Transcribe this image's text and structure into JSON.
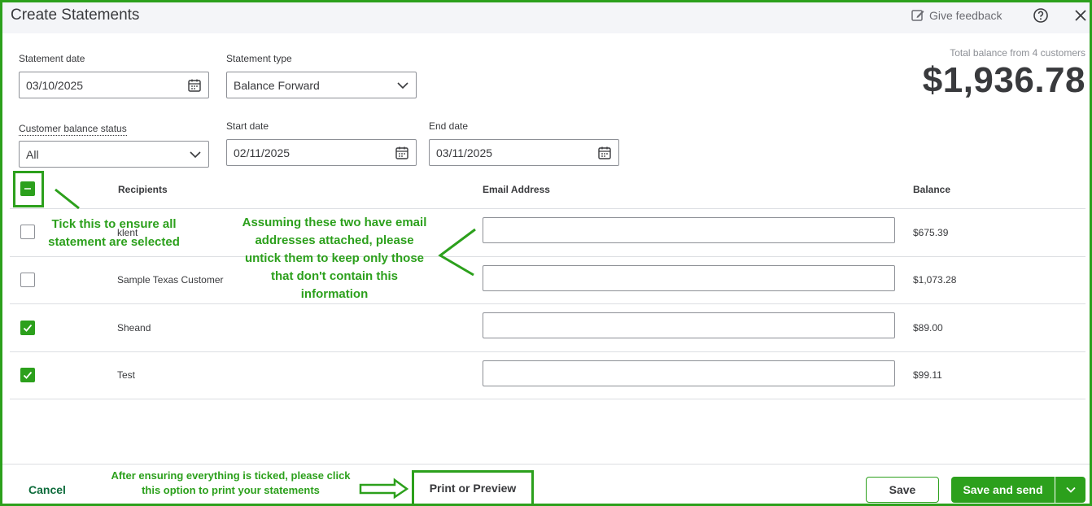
{
  "header": {
    "title": "Create Statements",
    "feedback_label": "Give feedback"
  },
  "form": {
    "statement_date_label": "Statement date",
    "statement_date_value": "03/10/2025",
    "statement_type_label": "Statement type",
    "statement_type_value": "Balance Forward",
    "balance_status_label": "Customer balance status",
    "balance_status_value": "All",
    "start_date_label": "Start date",
    "start_date_value": "02/11/2025",
    "end_date_label": "End date",
    "end_date_value": "03/11/2025"
  },
  "summary": {
    "total_label": "Total balance from 4 customers",
    "total_amount": "$1,936.78"
  },
  "table": {
    "columns": {
      "recipients": "Recipients",
      "email": "Email Address",
      "balance": "Balance"
    },
    "rows": [
      {
        "name": "klent",
        "email": "",
        "balance": "$675.39",
        "checked": false
      },
      {
        "name": "Sample Texas Customer",
        "email": "",
        "balance": "$1,073.28",
        "checked": false
      },
      {
        "name": "Sheand",
        "email": "",
        "balance": "$89.00",
        "checked": true
      },
      {
        "name": "Test",
        "email": "",
        "balance": "$99.11",
        "checked": true
      }
    ]
  },
  "annotations": {
    "select_all_note": "Tick this to ensure all statement are selected",
    "email_note": "Assuming these two have email addresses attached, please untick them to keep only those that don't contain this information",
    "print_note": "After ensuring everything is ticked, please click this option to print your statements"
  },
  "footer": {
    "cancel_label": "Cancel",
    "print_label": "Print or Preview",
    "save_label": "Save",
    "save_send_label": "Save and send"
  },
  "colors": {
    "accent": "#2ca01c",
    "cancel_text": "#0d6b3b"
  }
}
